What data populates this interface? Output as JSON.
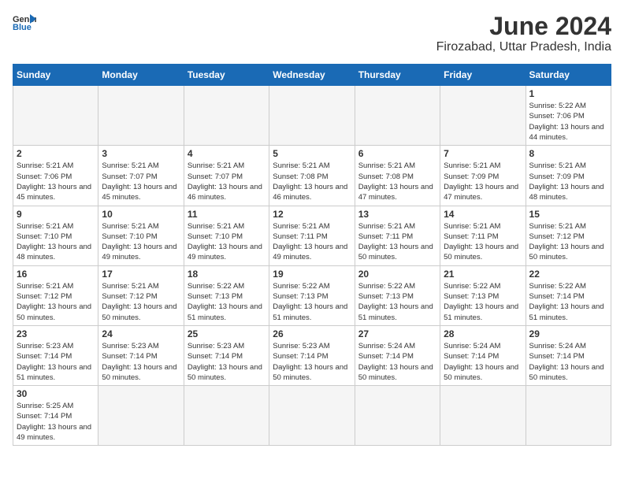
{
  "header": {
    "logo_general": "General",
    "logo_blue": "Blue",
    "month_title": "June 2024",
    "location": "Firozabad, Uttar Pradesh, India"
  },
  "weekdays": [
    "Sunday",
    "Monday",
    "Tuesday",
    "Wednesday",
    "Thursday",
    "Friday",
    "Saturday"
  ],
  "days": [
    {
      "date": "",
      "sunrise": "",
      "sunset": "",
      "daylight": ""
    },
    {
      "date": "",
      "sunrise": "",
      "sunset": "",
      "daylight": ""
    },
    {
      "date": "",
      "sunrise": "",
      "sunset": "",
      "daylight": ""
    },
    {
      "date": "",
      "sunrise": "",
      "sunset": "",
      "daylight": ""
    },
    {
      "date": "",
      "sunrise": "",
      "sunset": "",
      "daylight": ""
    },
    {
      "date": "",
      "sunrise": "",
      "sunset": "",
      "daylight": ""
    },
    {
      "date": "1",
      "sunrise": "Sunrise: 5:22 AM",
      "sunset": "Sunset: 7:06 PM",
      "daylight": "Daylight: 13 hours and 44 minutes."
    },
    {
      "date": "2",
      "sunrise": "Sunrise: 5:21 AM",
      "sunset": "Sunset: 7:06 PM",
      "daylight": "Daylight: 13 hours and 45 minutes."
    },
    {
      "date": "3",
      "sunrise": "Sunrise: 5:21 AM",
      "sunset": "Sunset: 7:07 PM",
      "daylight": "Daylight: 13 hours and 45 minutes."
    },
    {
      "date": "4",
      "sunrise": "Sunrise: 5:21 AM",
      "sunset": "Sunset: 7:07 PM",
      "daylight": "Daylight: 13 hours and 46 minutes."
    },
    {
      "date": "5",
      "sunrise": "Sunrise: 5:21 AM",
      "sunset": "Sunset: 7:08 PM",
      "daylight": "Daylight: 13 hours and 46 minutes."
    },
    {
      "date": "6",
      "sunrise": "Sunrise: 5:21 AM",
      "sunset": "Sunset: 7:08 PM",
      "daylight": "Daylight: 13 hours and 47 minutes."
    },
    {
      "date": "7",
      "sunrise": "Sunrise: 5:21 AM",
      "sunset": "Sunset: 7:09 PM",
      "daylight": "Daylight: 13 hours and 47 minutes."
    },
    {
      "date": "8",
      "sunrise": "Sunrise: 5:21 AM",
      "sunset": "Sunset: 7:09 PM",
      "daylight": "Daylight: 13 hours and 48 minutes."
    },
    {
      "date": "9",
      "sunrise": "Sunrise: 5:21 AM",
      "sunset": "Sunset: 7:10 PM",
      "daylight": "Daylight: 13 hours and 48 minutes."
    },
    {
      "date": "10",
      "sunrise": "Sunrise: 5:21 AM",
      "sunset": "Sunset: 7:10 PM",
      "daylight": "Daylight: 13 hours and 49 minutes."
    },
    {
      "date": "11",
      "sunrise": "Sunrise: 5:21 AM",
      "sunset": "Sunset: 7:10 PM",
      "daylight": "Daylight: 13 hours and 49 minutes."
    },
    {
      "date": "12",
      "sunrise": "Sunrise: 5:21 AM",
      "sunset": "Sunset: 7:11 PM",
      "daylight": "Daylight: 13 hours and 49 minutes."
    },
    {
      "date": "13",
      "sunrise": "Sunrise: 5:21 AM",
      "sunset": "Sunset: 7:11 PM",
      "daylight": "Daylight: 13 hours and 50 minutes."
    },
    {
      "date": "14",
      "sunrise": "Sunrise: 5:21 AM",
      "sunset": "Sunset: 7:11 PM",
      "daylight": "Daylight: 13 hours and 50 minutes."
    },
    {
      "date": "15",
      "sunrise": "Sunrise: 5:21 AM",
      "sunset": "Sunset: 7:12 PM",
      "daylight": "Daylight: 13 hours and 50 minutes."
    },
    {
      "date": "16",
      "sunrise": "Sunrise: 5:21 AM",
      "sunset": "Sunset: 7:12 PM",
      "daylight": "Daylight: 13 hours and 50 minutes."
    },
    {
      "date": "17",
      "sunrise": "Sunrise: 5:21 AM",
      "sunset": "Sunset: 7:12 PM",
      "daylight": "Daylight: 13 hours and 50 minutes."
    },
    {
      "date": "18",
      "sunrise": "Sunrise: 5:22 AM",
      "sunset": "Sunset: 7:13 PM",
      "daylight": "Daylight: 13 hours and 51 minutes."
    },
    {
      "date": "19",
      "sunrise": "Sunrise: 5:22 AM",
      "sunset": "Sunset: 7:13 PM",
      "daylight": "Daylight: 13 hours and 51 minutes."
    },
    {
      "date": "20",
      "sunrise": "Sunrise: 5:22 AM",
      "sunset": "Sunset: 7:13 PM",
      "daylight": "Daylight: 13 hours and 51 minutes."
    },
    {
      "date": "21",
      "sunrise": "Sunrise: 5:22 AM",
      "sunset": "Sunset: 7:13 PM",
      "daylight": "Daylight: 13 hours and 51 minutes."
    },
    {
      "date": "22",
      "sunrise": "Sunrise: 5:22 AM",
      "sunset": "Sunset: 7:14 PM",
      "daylight": "Daylight: 13 hours and 51 minutes."
    },
    {
      "date": "23",
      "sunrise": "Sunrise: 5:23 AM",
      "sunset": "Sunset: 7:14 PM",
      "daylight": "Daylight: 13 hours and 51 minutes."
    },
    {
      "date": "24",
      "sunrise": "Sunrise: 5:23 AM",
      "sunset": "Sunset: 7:14 PM",
      "daylight": "Daylight: 13 hours and 50 minutes."
    },
    {
      "date": "25",
      "sunrise": "Sunrise: 5:23 AM",
      "sunset": "Sunset: 7:14 PM",
      "daylight": "Daylight: 13 hours and 50 minutes."
    },
    {
      "date": "26",
      "sunrise": "Sunrise: 5:23 AM",
      "sunset": "Sunset: 7:14 PM",
      "daylight": "Daylight: 13 hours and 50 minutes."
    },
    {
      "date": "27",
      "sunrise": "Sunrise: 5:24 AM",
      "sunset": "Sunset: 7:14 PM",
      "daylight": "Daylight: 13 hours and 50 minutes."
    },
    {
      "date": "28",
      "sunrise": "Sunrise: 5:24 AM",
      "sunset": "Sunset: 7:14 PM",
      "daylight": "Daylight: 13 hours and 50 minutes."
    },
    {
      "date": "29",
      "sunrise": "Sunrise: 5:24 AM",
      "sunset": "Sunset: 7:14 PM",
      "daylight": "Daylight: 13 hours and 50 minutes."
    },
    {
      "date": "30",
      "sunrise": "Sunrise: 5:25 AM",
      "sunset": "Sunset: 7:14 PM",
      "daylight": "Daylight: 13 hours and 49 minutes."
    }
  ]
}
